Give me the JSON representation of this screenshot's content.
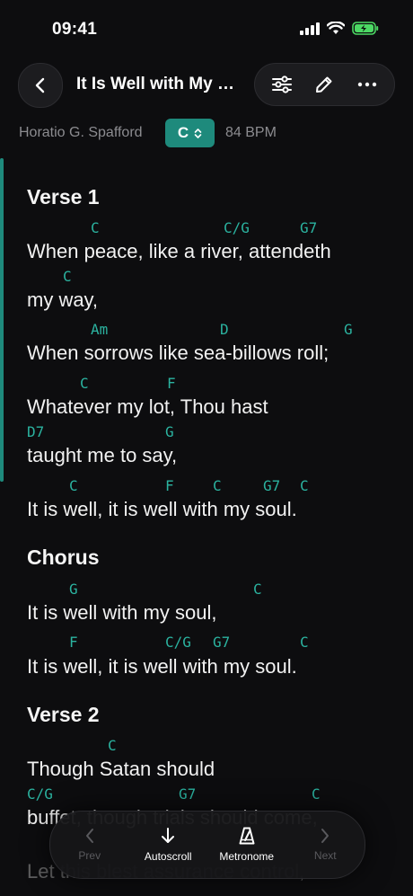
{
  "status": {
    "time": "09:41"
  },
  "header": {
    "title": "It Is Well with My Soul",
    "back_icon": "chevron-left-icon",
    "actions": [
      "sliders-icon",
      "pencil-icon",
      "more-icon"
    ]
  },
  "meta": {
    "author": "Horatio G. Spafford",
    "key": "C",
    "bpm": "84 BPM"
  },
  "colors": {
    "accent": "#1e8a7c",
    "chord": "#2bb3a0",
    "background": "#0d0d0f"
  },
  "sheet": {
    "sections": [
      "Verse 1",
      "Chorus",
      "Verse 2"
    ],
    "lines": [
      {
        "lyric": "When peace, like a river, attendeth",
        "chords": [
          "C",
          "C/G",
          "G7"
        ]
      },
      {
        "lyric": "my way,",
        "chords": [
          "C"
        ]
      },
      {
        "lyric": "When sorrows like sea-billows roll;",
        "chords": [
          "Am",
          "D",
          "G"
        ]
      },
      {
        "lyric": "Whatever my lot, Thou hast",
        "chords": [
          "C",
          "F"
        ]
      },
      {
        "lyric": "taught me to say,",
        "chords": [
          "D7",
          "G"
        ]
      },
      {
        "lyric": "It is well, it is well with my soul.",
        "chords": [
          "C",
          "F",
          "C",
          "G7",
          "C"
        ]
      },
      {
        "lyric": "It is well with my soul,",
        "chords": [
          "G",
          "C"
        ]
      },
      {
        "lyric": "It is well, it is well with my soul.",
        "chords": [
          "F",
          "C/G",
          "G7",
          "C"
        ]
      },
      {
        "lyric": "Though Satan should",
        "chords": [
          "C"
        ]
      },
      {
        "lyric": "buffet, though trials should come,",
        "chords": [
          "C/G",
          "G7",
          "C"
        ]
      },
      {
        "lyric": "Let this blest assurance control,",
        "chords": []
      }
    ]
  },
  "toolbar": {
    "prev": "Prev",
    "autoscroll": "Autoscroll",
    "metronome": "Metronome",
    "next": "Next"
  }
}
